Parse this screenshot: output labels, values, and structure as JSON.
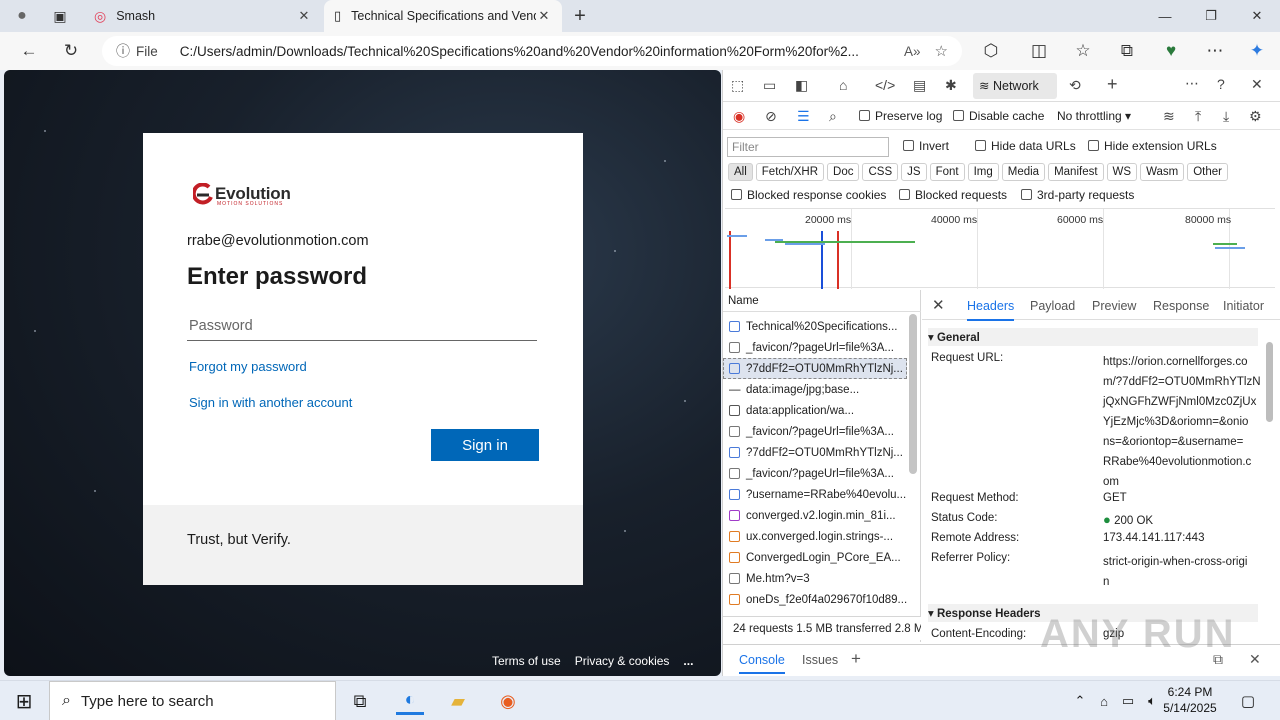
{
  "browser": {
    "tabs": [
      {
        "label": "Smash"
      },
      {
        "label": "Technical Specifications and Vendor information Form"
      }
    ],
    "address": {
      "info_label": "File",
      "url": "C:/Users/admin/Downloads/Technical%20Specifications%20and%20Vendor%20information%20Form%20for%2..."
    }
  },
  "page": {
    "logo_text": "Evolution",
    "logo_subtext": "MOTION SOLUTIONS",
    "email": "rrabe@evolutionmotion.com",
    "heading": "Enter password",
    "password_placeholder": "Password",
    "forgot_link": "Forgot my password",
    "other_account_link": "Sign in with another account",
    "signin_button": "Sign in",
    "footer_text": "Trust, but Verify.",
    "terms": "Terms of use",
    "privacy": "Privacy & cookies",
    "more": "..."
  },
  "devtools": {
    "active_panel": "Network",
    "toolbar": {
      "preserve_log": "Preserve log",
      "disable_cache": "Disable cache",
      "throttling": "No throttling"
    },
    "filter_placeholder": "Filter",
    "filter_options": {
      "invert": "Invert",
      "hide_data": "Hide data URLs",
      "hide_ext": "Hide extension URLs"
    },
    "type_chips": [
      "All",
      "Fetch/XHR",
      "Doc",
      "CSS",
      "JS",
      "Font",
      "Img",
      "Media",
      "Manifest",
      "WS",
      "Wasm",
      "Other"
    ],
    "block_options": {
      "blocked_cookies": "Blocked response cookies",
      "blocked_requests": "Blocked requests",
      "third_party": "3rd-party requests"
    },
    "timeline_labels": [
      "20000 ms",
      "40000 ms",
      "60000 ms",
      "80000 ms"
    ],
    "name_header": "Name",
    "requests": [
      "Technical%20Specifications...",
      "_favicon/?pageUrl=file%3A...",
      "?7ddFf2=OTU0MmRhYTlzNj...",
      "data:image/jpg;base...",
      "data:application/wa...",
      "_favicon/?pageUrl=file%3A...",
      "?7ddFf2=OTU0MmRhYTlzNj...",
      "_favicon/?pageUrl=file%3A...",
      "?username=RRabe%40evolu...",
      "converged.v2.login.min_81i...",
      "ux.converged.login.strings-...",
      "ConvergedLogin_PCore_EA...",
      "Me.htm?v=3",
      "oneDs_f2e0f4a029670f10d89..."
    ],
    "summary": "24 requests   1.5 MB transferred   2.8 MB",
    "detail_tabs": [
      "Headers",
      "Payload",
      "Preview",
      "Response",
      "Initiator"
    ],
    "general_section": "General",
    "general": {
      "request_url_key": "Request URL:",
      "request_url_lines": [
        "https://orion.cornellforges.co",
        "m/?7ddFf2=OTU0MmRhYTlzN",
        "jQxNGFhZWFjNml0Mzc0ZjUx",
        "YjEzMjc%3D&oriomn=&onio",
        "ns=&oriontop=&username=",
        "RRabe%40evolutionmotion.c",
        "om"
      ],
      "method_key": "Request Method:",
      "method": "GET",
      "status_key": "Status Code:",
      "status": "200 OK",
      "remote_key": "Remote Address:",
      "remote": "173.44.141.117:443",
      "referrer_key": "Referrer Policy:",
      "referrer_lines": [
        "strict-origin-when-cross-origi",
        "n"
      ]
    },
    "response_section": "Response Headers",
    "encoding_key": "Content-Encoding:",
    "encoding_value": "gzip",
    "drawer_tabs": [
      "Console",
      "Issues"
    ]
  },
  "taskbar": {
    "search_placeholder": "Type here to search",
    "time": "6:24 PM",
    "date": "5/14/2025"
  },
  "watermark": "ANY RUN"
}
